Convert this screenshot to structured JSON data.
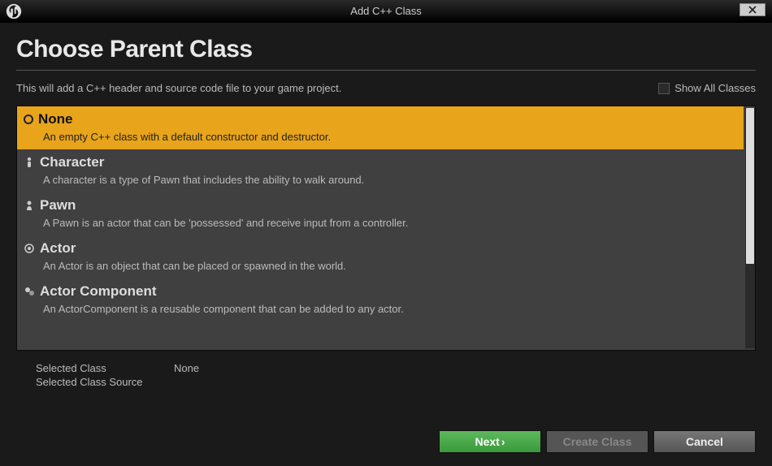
{
  "window": {
    "title": "Add C++ Class"
  },
  "header": {
    "page_title": "Choose Parent Class",
    "description": "This will add a C++ header and source code file to your game project.",
    "show_all_label": "Show All Classes",
    "show_all_checked": false
  },
  "classes": [
    {
      "name": "None",
      "description": "An empty C++ class with a default constructor and destructor.",
      "selected": true,
      "icon": "none"
    },
    {
      "name": "Character",
      "description": "A character is a type of Pawn that includes the ability to walk around.",
      "selected": false,
      "icon": "character"
    },
    {
      "name": "Pawn",
      "description": "A Pawn is an actor that can be 'possessed' and receive input from a controller.",
      "selected": false,
      "icon": "pawn"
    },
    {
      "name": "Actor",
      "description": "An Actor is an object that can be placed or spawned in the world.",
      "selected": false,
      "icon": "actor"
    },
    {
      "name": "Actor Component",
      "description": "An ActorComponent is a reusable component that can be added to any actor.",
      "selected": false,
      "icon": "component"
    }
  ],
  "selected": {
    "class_label": "Selected Class",
    "class_value": "None",
    "source_label": "Selected Class Source",
    "source_value": ""
  },
  "buttons": {
    "next": "Next",
    "create": "Create Class",
    "cancel": "Cancel"
  }
}
